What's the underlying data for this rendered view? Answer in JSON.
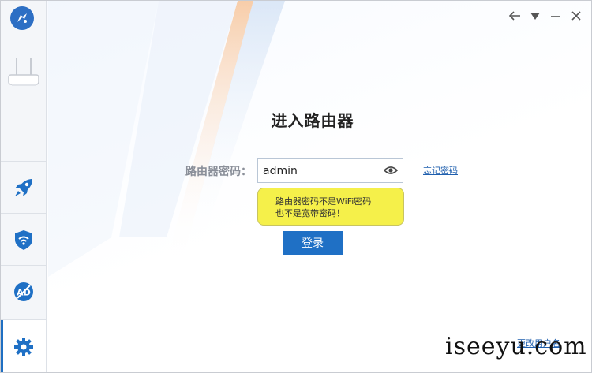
{
  "main": {
    "title": "进入路由器",
    "password_label": "路由器密码：",
    "password_value": "admin",
    "forgot_link": "忘记密码",
    "tip_line1": "路由器密码不是WiFi密码",
    "tip_line2": "也不是宽带密码！",
    "login_button": "登录",
    "change_user_link": "更改用户名"
  },
  "sidebar": {
    "items": [
      {
        "icon": "rocket-icon"
      },
      {
        "icon": "wifi-shield-icon"
      },
      {
        "icon": "ad-block-icon"
      },
      {
        "icon": "gear-icon",
        "active": true
      }
    ]
  },
  "titlebar": {
    "controls": [
      "back-arrow-icon",
      "dropdown-triangle-icon",
      "minimize-icon",
      "close-icon"
    ]
  },
  "watermark": "iseeyu.com",
  "colors": {
    "accent": "#1f70c5",
    "tip_background": "#f5f04a",
    "link": "#1f5fae"
  }
}
